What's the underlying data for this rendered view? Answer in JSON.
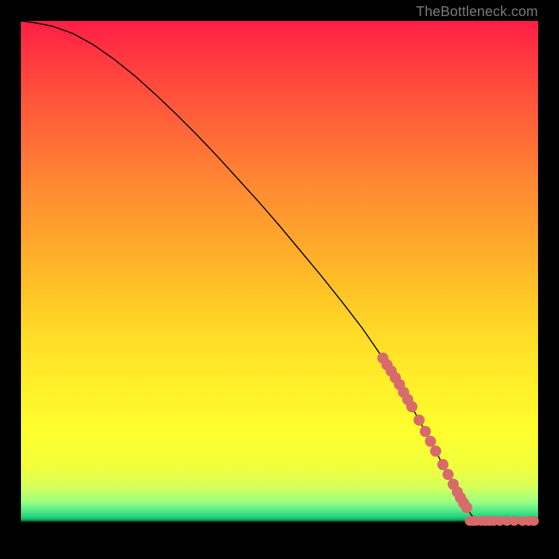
{
  "watermark": "TheBottleneck.com",
  "colors": {
    "background": "#000000",
    "gradient_top": "#ff1e46",
    "gradient_mid": "#ffe628",
    "gradient_green": "#1fcf7a",
    "curve_stroke": "#000000",
    "marker_fill": "#d76b6b"
  },
  "chart_data": {
    "type": "line",
    "title": "",
    "xlabel": "",
    "ylabel": "",
    "xlim": [
      0,
      100
    ],
    "ylim": [
      0,
      100
    ],
    "grid": false,
    "legend": false,
    "series": [
      {
        "name": "curve",
        "x": [
          0,
          3,
          6,
          10,
          14,
          18,
          22,
          26,
          30,
          34,
          38,
          42,
          46,
          50,
          54,
          58,
          62,
          66,
          70,
          72,
          74,
          76,
          78,
          80,
          82,
          84,
          85.5,
          87,
          88,
          90,
          92,
          94,
          96,
          98,
          100
        ],
        "y": [
          100,
          99.6,
          99.0,
          97.6,
          95.4,
          92.6,
          89.4,
          85.8,
          82.0,
          78.0,
          73.8,
          69.4,
          65.0,
          60.4,
          55.6,
          50.8,
          45.8,
          40.6,
          34.8,
          31.6,
          28.2,
          24.6,
          21.0,
          17.2,
          13.4,
          9.6,
          7.0,
          4.6,
          3.4,
          3.2,
          3.2,
          3.2,
          3.2,
          3.2,
          3.2
        ]
      }
    ],
    "markers_on_curve": {
      "name": "highlight-segment",
      "x": [
        70.0,
        70.8,
        71.6,
        72.4,
        73.2,
        74.0,
        74.8,
        75.6,
        77.0,
        78.2,
        79.2,
        80.2,
        81.6,
        82.6,
        83.6,
        84.4,
        85.0,
        85.6,
        86.2
      ],
      "y": [
        34.8,
        33.5,
        32.3,
        31.0,
        29.7,
        28.2,
        26.8,
        25.4,
        22.8,
        20.6,
        18.7,
        16.8,
        14.2,
        12.3,
        10.4,
        8.9,
        7.8,
        6.8,
        5.9
      ]
    },
    "markers_flat": {
      "name": "flat-tail",
      "x": [
        86.8,
        87.4,
        88.0,
        89.0,
        89.8,
        90.6,
        91.4,
        92.6,
        94.0,
        95.4,
        97.0,
        98.2,
        99.2
      ],
      "y": [
        3.3,
        3.3,
        3.3,
        3.3,
        3.3,
        3.3,
        3.3,
        3.3,
        3.3,
        3.3,
        3.3,
        3.3,
        3.3
      ]
    }
  }
}
